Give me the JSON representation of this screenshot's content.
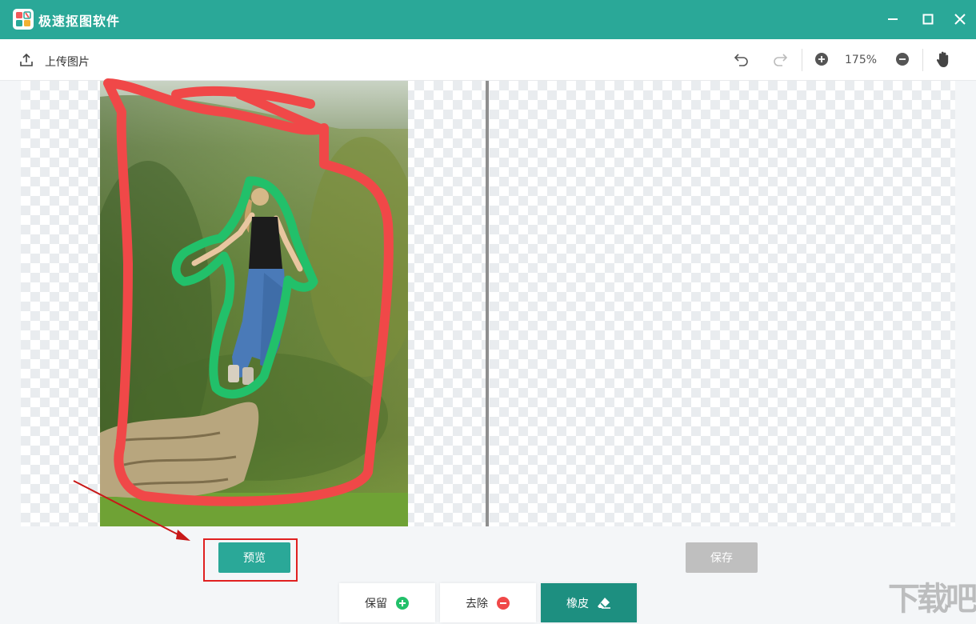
{
  "app": {
    "title": "极速抠图软件"
  },
  "toolbar": {
    "upload_label": "上传图片",
    "zoom_level": "175%"
  },
  "actions": {
    "preview_label": "预览",
    "save_label": "保存"
  },
  "tools": {
    "keep_label": "保留",
    "remove_label": "去除",
    "eraser_label": "橡皮"
  },
  "watermark": "下载吧",
  "colors": {
    "accent": "#2aa898",
    "keep_stroke": "#22c06a",
    "remove_stroke": "#f04848",
    "highlight": "#e02020",
    "disabled": "#bfbfbf"
  },
  "icons": [
    "app-logo-icon",
    "minimize-icon",
    "maximize-icon",
    "close-icon",
    "upload-icon",
    "undo-icon",
    "redo-icon",
    "zoom-in-icon",
    "zoom-out-icon",
    "hand-icon",
    "plus-circle-icon",
    "minus-circle-icon",
    "eraser-icon"
  ]
}
